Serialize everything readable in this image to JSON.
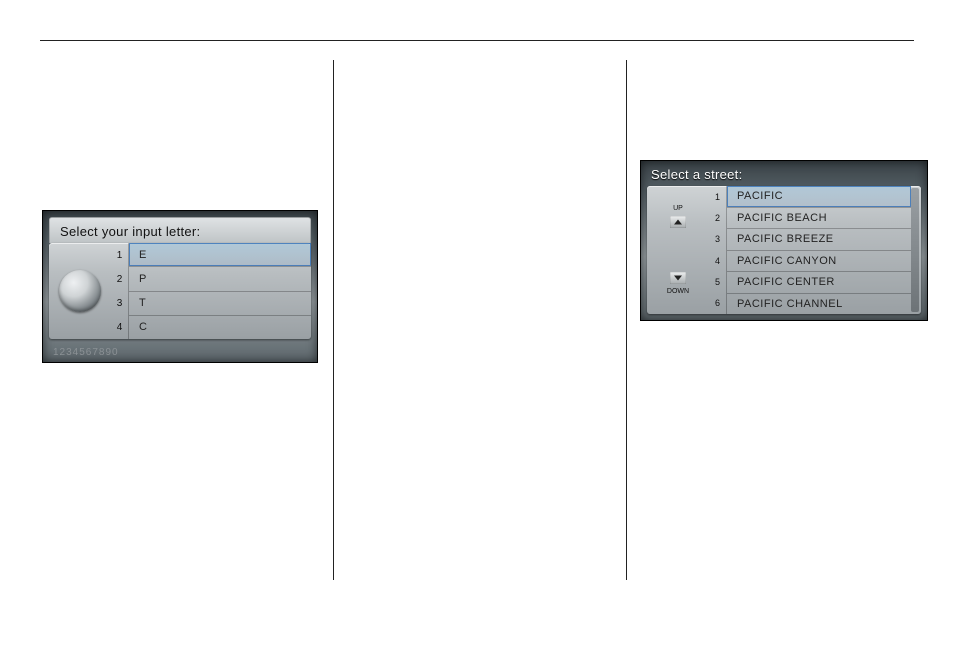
{
  "panelLeft": {
    "title": "Select your input letter:",
    "rows": [
      "E",
      "P",
      "T",
      "C"
    ],
    "nums": [
      "1",
      "2",
      "3",
      "4"
    ],
    "footer": "1234567890"
  },
  "panelRight": {
    "title": "Select a street:",
    "rows": [
      "PACIFIC",
      "PACIFIC BEACH",
      "PACIFIC BREEZE",
      "PACIFIC CANYON",
      "PACIFIC CENTER",
      "PACIFIC CHANNEL"
    ],
    "nums": [
      "1",
      "2",
      "3",
      "4",
      "5",
      "6"
    ],
    "upLabel": "UP",
    "downLabel": "DOWN"
  }
}
